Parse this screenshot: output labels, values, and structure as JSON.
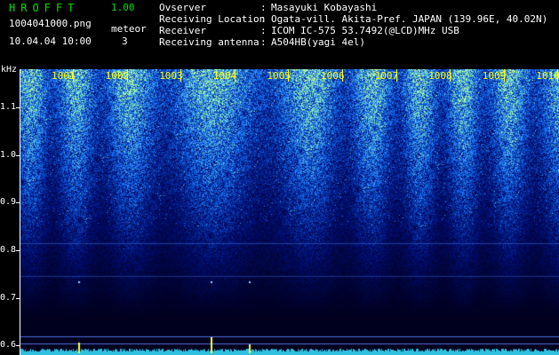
{
  "header": {
    "app_name": "HROFFT",
    "app_version": "1.00",
    "file_name": "1004041000.png",
    "mode_label": "meteor",
    "date_time": "10.04.04 10:00",
    "count_value": "3"
  },
  "info": {
    "rows": [
      {
        "key": "Ovserver",
        "value": "Masayuki Kobayashi"
      },
      {
        "key": "Receiving Location",
        "value": "Ogata-vill. Akita-Pref. JAPAN (139.96E, 40.02N)"
      },
      {
        "key": "Receiver",
        "value": "ICOM IC-575 53.7492(@LCD)MHz USB"
      },
      {
        "key": "Receiving antenna",
        "value": "A504HB(yagi 4el)"
      }
    ],
    "separator": ":"
  },
  "axes": {
    "y_unit": "kHz",
    "y_ticks": [
      "1.1",
      "1.0",
      "0.9",
      "0.8",
      "0.7",
      "0.6"
    ],
    "x_ticks": [
      "1001",
      "1002",
      "1003",
      "1004",
      "1005",
      "1006",
      "1007",
      "1008",
      "1009",
      "1010"
    ]
  },
  "colors": {
    "background": "#000000",
    "label_green": "#00e000",
    "time_labels": "#ffff00",
    "text": "#ffffff",
    "noise_low": "#000a30",
    "noise_mid": "#1030c0",
    "noise_high": "#40d0c0",
    "meteor": "#ffff40"
  },
  "chart_data": {
    "type": "heatmap",
    "title": "",
    "xlabel": "",
    "ylabel": "kHz",
    "x_ticks": [
      "1001",
      "1002",
      "1003",
      "1004",
      "1005",
      "1006",
      "1007",
      "1008",
      "1009",
      "1010"
    ],
    "ylim": [
      0.58,
      1.18
    ],
    "y_ticks": [
      0.6,
      0.7,
      0.8,
      0.9,
      1.0,
      1.1
    ],
    "meteor_echoes_count": 3,
    "horizontal_lines_khz": [
      0.62,
      0.605
    ]
  }
}
